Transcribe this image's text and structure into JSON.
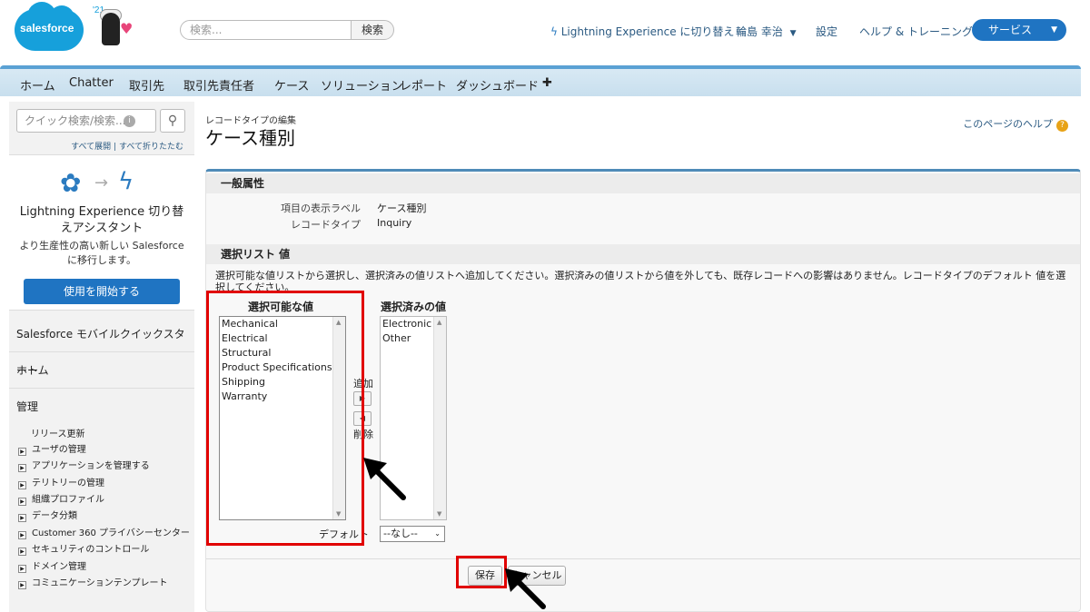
{
  "header": {
    "logo_text": "salesforce",
    "mascot_year": "'21",
    "search_placeholder": "検索...",
    "search_button": "検索",
    "lightning_link": "Lightning Experience に切り替え",
    "user_menu": "輪島 幸治",
    "settings_link": "設定",
    "help_link": "ヘルプ & トレーニング",
    "app_menu": "サービス"
  },
  "tabs": [
    "ホーム",
    "Chatter",
    "取引先",
    "取引先責任者",
    "ケース",
    "ソリューション",
    "レポート",
    "ダッシュボード",
    "✚"
  ],
  "sidebar": {
    "quick_search_placeholder": "クイック検索/検索...",
    "expand_all": "すべて展開",
    "separator": "|",
    "collapse_all": "すべて折りたたむ",
    "lx_title": "Lightning Experience 切り替えアシスタント",
    "lx_desc": "より生産性の高い新しい Salesforce に移行します。",
    "lx_button": "使用を開始する",
    "mobile_quickstart": "Salesforce モバイルクイックスタート",
    "home": "ホーム",
    "admin": "管理",
    "release_updates": "リリース更新",
    "admin_items": [
      "ユーザの管理",
      "アプリケーションを管理する",
      "テリトリーの管理",
      "組織プロファイル",
      "データ分類",
      "Customer 360 プライバシーセンター",
      "セキュリティのコントロール",
      "ドメイン管理",
      "コミュニケーションテンプレート"
    ]
  },
  "main": {
    "breadcrumb": "レコードタイプの編集",
    "title": "ケース種別",
    "help_link": "このページのヘルプ",
    "general_section": "一般属性",
    "field_label_label": "項目の表示ラベル",
    "field_label_value": "ケース種別",
    "record_type_label": "レコードタイプ",
    "record_type_value": "Inquiry",
    "picklist_section": "選択リスト 値",
    "instructions": "選択可能な値リストから選択し、選択済みの値リストへ追加してください。選択済みの値リストから値を外しても、既存レコードへの影響はありません。レコードタイプのデフォルト 値を選択してください。",
    "available_title": "選択可能な値",
    "available_values": [
      "Mechanical",
      "Electrical",
      "Structural",
      "Product Specifications",
      "Shipping",
      "Warranty"
    ],
    "selected_title": "選択済みの値",
    "selected_values": [
      "Electronic",
      "Other"
    ],
    "add_label": "追加",
    "remove_label": "削除",
    "default_label": "デフォルト",
    "default_value": "--なし--",
    "save_button": "保存",
    "cancel_button": "キャンセル"
  },
  "annotations": {
    "highlight_color": "#e10000",
    "arrow_color": "#000000"
  }
}
